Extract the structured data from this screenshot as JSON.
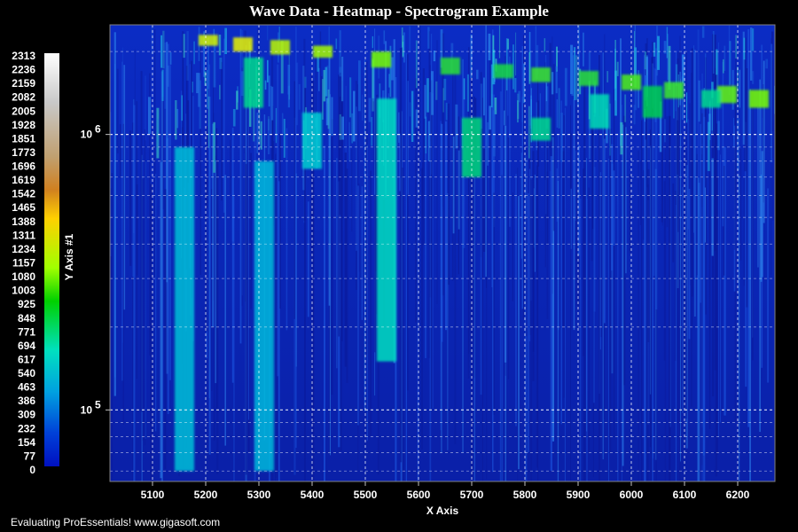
{
  "chart_data": {
    "type": "heatmap",
    "title": "Wave Data - Heatmap - Spectrogram Example",
    "xlabel": "X Axis",
    "ylabel": "Y Axis #1",
    "xlim": [
      5020,
      6270
    ],
    "ylim": [
      55000,
      2500000
    ],
    "y_scale": "log",
    "x_ticks": [
      "5100",
      "5200",
      "5300",
      "5400",
      "5500",
      "5600",
      "5700",
      "5800",
      "5900",
      "6000",
      "6100",
      "6200"
    ],
    "y_ticks": [
      {
        "base": "10",
        "exp": "5",
        "value": 100000
      },
      {
        "base": "10",
        "exp": "6",
        "value": 1000000
      }
    ],
    "grid": true,
    "colorbar": {
      "labels": [
        "2313",
        "2236",
        "2159",
        "2082",
        "2005",
        "1928",
        "1851",
        "1773",
        "1696",
        "1619",
        "1542",
        "1465",
        "1388",
        "1311",
        "1234",
        "1157",
        "1080",
        "1003",
        "925",
        "848",
        "771",
        "694",
        "617",
        "540",
        "463",
        "386",
        "309",
        "232",
        "154",
        "77",
        "0"
      ],
      "colors": [
        "#ffffff",
        "#f0f0f0",
        "#e0e0e0",
        "#c8c8c8",
        "#b0b0b0",
        "#a89080",
        "#b08050",
        "#c08030",
        "#d09020",
        "#f0c000",
        "#ffff00",
        "#c0ff00",
        "#60e000",
        "#00d000",
        "#00e080",
        "#00e0c0",
        "#00c0d0",
        "#0090e0",
        "#0060e0",
        "#0030d0",
        "#0010c0"
      ]
    },
    "background_color": "#0a1fb0",
    "ridges": [
      {
        "x": 5205,
        "y_top": 2300000,
        "y_bottom": 2100000,
        "intensity": 1300
      },
      {
        "x": 5270,
        "y_top": 2250000,
        "y_bottom": 2000000,
        "intensity": 1350
      },
      {
        "x": 5340,
        "y_top": 2200000,
        "y_bottom": 1950000,
        "intensity": 1250
      },
      {
        "x": 5420,
        "y_top": 2100000,
        "y_bottom": 1900000,
        "intensity": 1200
      },
      {
        "x": 5530,
        "y_top": 2000000,
        "y_bottom": 1750000,
        "intensity": 1100
      },
      {
        "x": 5660,
        "y_top": 1900000,
        "y_bottom": 1650000,
        "intensity": 900
      },
      {
        "x": 5760,
        "y_top": 1800000,
        "y_bottom": 1600000,
        "intensity": 850
      },
      {
        "x": 5830,
        "y_top": 1750000,
        "y_bottom": 1550000,
        "intensity": 950
      },
      {
        "x": 5920,
        "y_top": 1700000,
        "y_bottom": 1500000,
        "intensity": 900
      },
      {
        "x": 6000,
        "y_top": 1650000,
        "y_bottom": 1450000,
        "intensity": 1000
      },
      {
        "x": 6080,
        "y_top": 1550000,
        "y_bottom": 1350000,
        "intensity": 950
      },
      {
        "x": 6180,
        "y_top": 1500000,
        "y_bottom": 1300000,
        "intensity": 1050
      },
      {
        "x": 6240,
        "y_top": 1450000,
        "y_bottom": 1250000,
        "intensity": 1100
      },
      {
        "x": 5290,
        "y_top": 1900000,
        "y_bottom": 1250000,
        "intensity": 650
      },
      {
        "x": 5540,
        "y_top": 1350000,
        "y_bottom": 150000,
        "intensity": 520
      },
      {
        "x": 5700,
        "y_top": 1150000,
        "y_bottom": 700000,
        "intensity": 700
      },
      {
        "x": 5830,
        "y_top": 1150000,
        "y_bottom": 950000,
        "intensity": 650
      },
      {
        "x": 5940,
        "y_top": 1400000,
        "y_bottom": 1050000,
        "intensity": 550
      },
      {
        "x": 6040,
        "y_top": 1500000,
        "y_bottom": 1150000,
        "intensity": 800
      },
      {
        "x": 6150,
        "y_top": 1450000,
        "y_bottom": 1250000,
        "intensity": 650
      },
      {
        "x": 5160,
        "y_top": 900000,
        "y_bottom": 60000,
        "intensity": 400
      },
      {
        "x": 5310,
        "y_top": 800000,
        "y_bottom": 60000,
        "intensity": 380
      },
      {
        "x": 5400,
        "y_top": 1200000,
        "y_bottom": 750000,
        "intensity": 450
      }
    ]
  },
  "footer": "Evaluating ProEssentials! www.gigasoft.com"
}
